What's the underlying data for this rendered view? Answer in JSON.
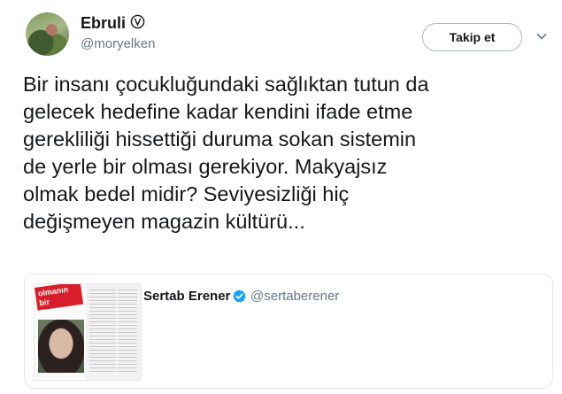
{
  "tweet": {
    "author_name": "Ebruli",
    "author_handle": "@moryelken",
    "follow_label": "Takip et",
    "text": "Bir insanı çocukluğundaki sağlıktan tutun da\ngelecek hedefine kadar kendini ifade etme\ngerekliliği hissettiği duruma sokan sistemin\nde yerle bir olması gerekiyor. Makyajsız\nolmak bedel midir? Seviyesizliği hiç\ndeğişmeyen magazin kültürü..."
  },
  "quoted": {
    "author_name": "Sertab Erener",
    "author_handle": "@sertaberener",
    "thumb_banner": "olmanın bir\nli var Sertab"
  },
  "icons": {
    "author_badge": "verified-outline-icon",
    "quoted_badge": "verified-blue-icon",
    "menu": "chevron-down-icon"
  },
  "colors": {
    "verified_blue": "#1da1f2",
    "secondary_text": "#657786",
    "banner_red": "#d61f2a"
  }
}
